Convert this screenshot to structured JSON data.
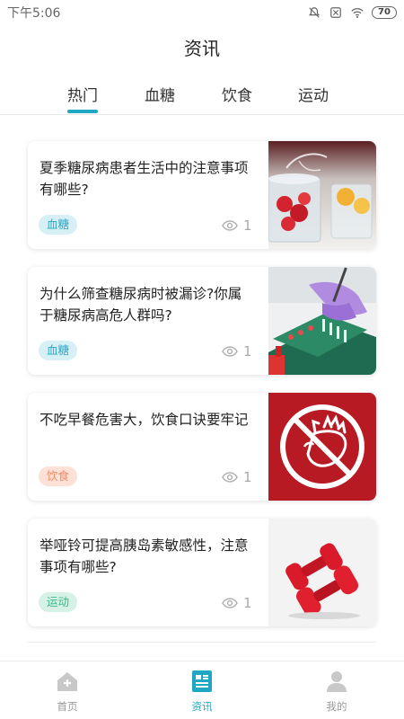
{
  "status_bar": {
    "time": "下午5:06",
    "battery": "70"
  },
  "header": {
    "title": "资讯"
  },
  "tabs": [
    {
      "label": "热门",
      "active": true
    },
    {
      "label": "血糖",
      "active": false
    },
    {
      "label": "饮食",
      "active": false
    },
    {
      "label": "运动",
      "active": false
    }
  ],
  "articles": [
    {
      "title": "夏季糖尿病患者生活中的注意事项有哪些?",
      "tag": "血糖",
      "tag_bg": "#d6f0f6",
      "tag_color": "#2aa8c8",
      "views": "1",
      "image": "strawberries-in-water-glass"
    },
    {
      "title": "为什么筛查糖尿病时被漏诊?你属于糖尿病高危人群吗?",
      "tag": "血糖",
      "tag_bg": "#d6f0f6",
      "tag_color": "#2aa8c8",
      "views": "1",
      "image": "lab-gloves-test-tubes"
    },
    {
      "title": " 不吃早餐危害大，饮食口诀要牢记",
      "tag": "饮食",
      "tag_bg": "#fde0d6",
      "tag_color": "#ef8a66",
      "views": "1",
      "image": "no-hand-prohibition-sign"
    },
    {
      "title": "举哑铃可提高胰岛素敏感性，注意事项有哪些?",
      "tag": "运动",
      "tag_bg": "#d6f2e6",
      "tag_color": "#3ab88a",
      "views": "1",
      "image": "red-dumbbells"
    }
  ],
  "bottom_nav": [
    {
      "label": "首页",
      "icon": "home-icon",
      "active": false
    },
    {
      "label": "资讯",
      "icon": "news-icon",
      "active": true
    },
    {
      "label": "我的",
      "icon": "profile-icon",
      "active": false
    }
  ],
  "colors": {
    "accent": "#1fa7c4"
  }
}
